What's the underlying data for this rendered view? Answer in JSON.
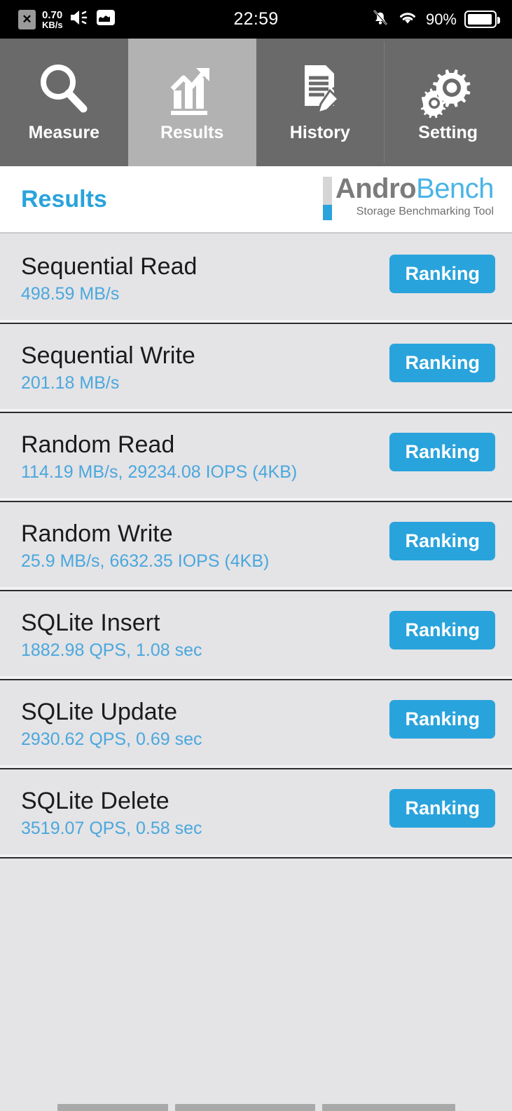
{
  "statusbar": {
    "sim_icon": "sim-card-x-icon",
    "network_speed_value": "0.70",
    "network_speed_unit": "KB/s",
    "volume_icon": "speaker-volume-icon",
    "app_icon": "app-notification-icon",
    "time": "22:59",
    "silent_icon": "bell-slash-icon",
    "wifi_icon": "wifi-icon",
    "battery_percent": "90%",
    "battery_icon": "battery-icon"
  },
  "tabs": [
    {
      "label": "Measure",
      "icon": "magnifier-icon",
      "active": false
    },
    {
      "label": "Results",
      "icon": "bar-chart-arrow-icon",
      "active": true
    },
    {
      "label": "History",
      "icon": "document-pencil-icon",
      "active": false
    },
    {
      "label": "Setting",
      "icon": "gears-icon",
      "active": false
    }
  ],
  "header": {
    "title": "Results",
    "logo_andro": "Andro",
    "logo_bench": "Bench",
    "logo_tagline": "Storage Benchmarking Tool"
  },
  "colors": {
    "accent_blue": "#29a3dc",
    "value_blue": "#4aa8dd",
    "logo_gray": "#7b7b7b",
    "tab_inactive": "#6a6a6a",
    "tab_active": "#b2b2b2",
    "list_bg": "#e4e3e6"
  },
  "results": [
    {
      "title": "Sequential Read",
      "value": "498.59 MB/s",
      "button": "Ranking"
    },
    {
      "title": "Sequential Write",
      "value": "201.18 MB/s",
      "button": "Ranking"
    },
    {
      "title": "Random Read",
      "value": "114.19 MB/s, 29234.08 IOPS (4KB)",
      "button": "Ranking"
    },
    {
      "title": "Random Write",
      "value": "25.9 MB/s, 6632.35 IOPS (4KB)",
      "button": "Ranking"
    },
    {
      "title": "SQLite Insert",
      "value": "1882.98 QPS, 1.08 sec",
      "button": "Ranking"
    },
    {
      "title": "SQLite Update",
      "value": "2930.62 QPS, 0.69 sec",
      "button": "Ranking"
    },
    {
      "title": "SQLite Delete",
      "value": "3519.07 QPS, 0.58 sec",
      "button": "Ranking"
    }
  ]
}
